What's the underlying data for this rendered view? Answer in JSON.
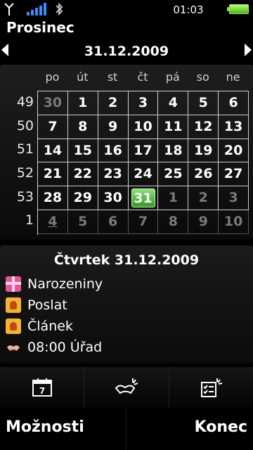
{
  "status": {
    "time": "01:03"
  },
  "app": {
    "title": "Prosinec"
  },
  "nav": {
    "date": "31.12.2009"
  },
  "calendar": {
    "weekdays": [
      "po",
      "út",
      "st",
      "čt",
      "pá",
      "so",
      "ne"
    ],
    "weeks": [
      "49",
      "50",
      "51",
      "52",
      "53",
      "1"
    ],
    "rows": [
      [
        "30",
        "1",
        "2",
        "3",
        "4",
        "5",
        "6"
      ],
      [
        "7",
        "8",
        "9",
        "10",
        "11",
        "12",
        "13"
      ],
      [
        "14",
        "15",
        "16",
        "17",
        "18",
        "19",
        "20"
      ],
      [
        "21",
        "22",
        "23",
        "24",
        "25",
        "26",
        "27"
      ],
      [
        "28",
        "29",
        "30",
        "31",
        "1",
        "2",
        "3"
      ],
      [
        "4",
        "5",
        "6",
        "7",
        "8",
        "9",
        "10"
      ]
    ]
  },
  "detail": {
    "heading": "Čtvrtek 31.12.2009",
    "events": [
      {
        "icon": "gift-icon",
        "text": "Narozeniny"
      },
      {
        "icon": "memo-icon",
        "text": "Poslat"
      },
      {
        "icon": "memo-icon",
        "text": "Článek"
      },
      {
        "icon": "meeting-icon",
        "text": "08:00 Úřad"
      }
    ]
  },
  "toolbar": {
    "items": [
      "calendar-day-icon",
      "new-meeting-icon",
      "new-todo-icon"
    ]
  },
  "softkeys": {
    "left": "Možnosti",
    "right": "Konec"
  },
  "colors": {
    "accent": "#4fb33a",
    "background": "#000000"
  }
}
